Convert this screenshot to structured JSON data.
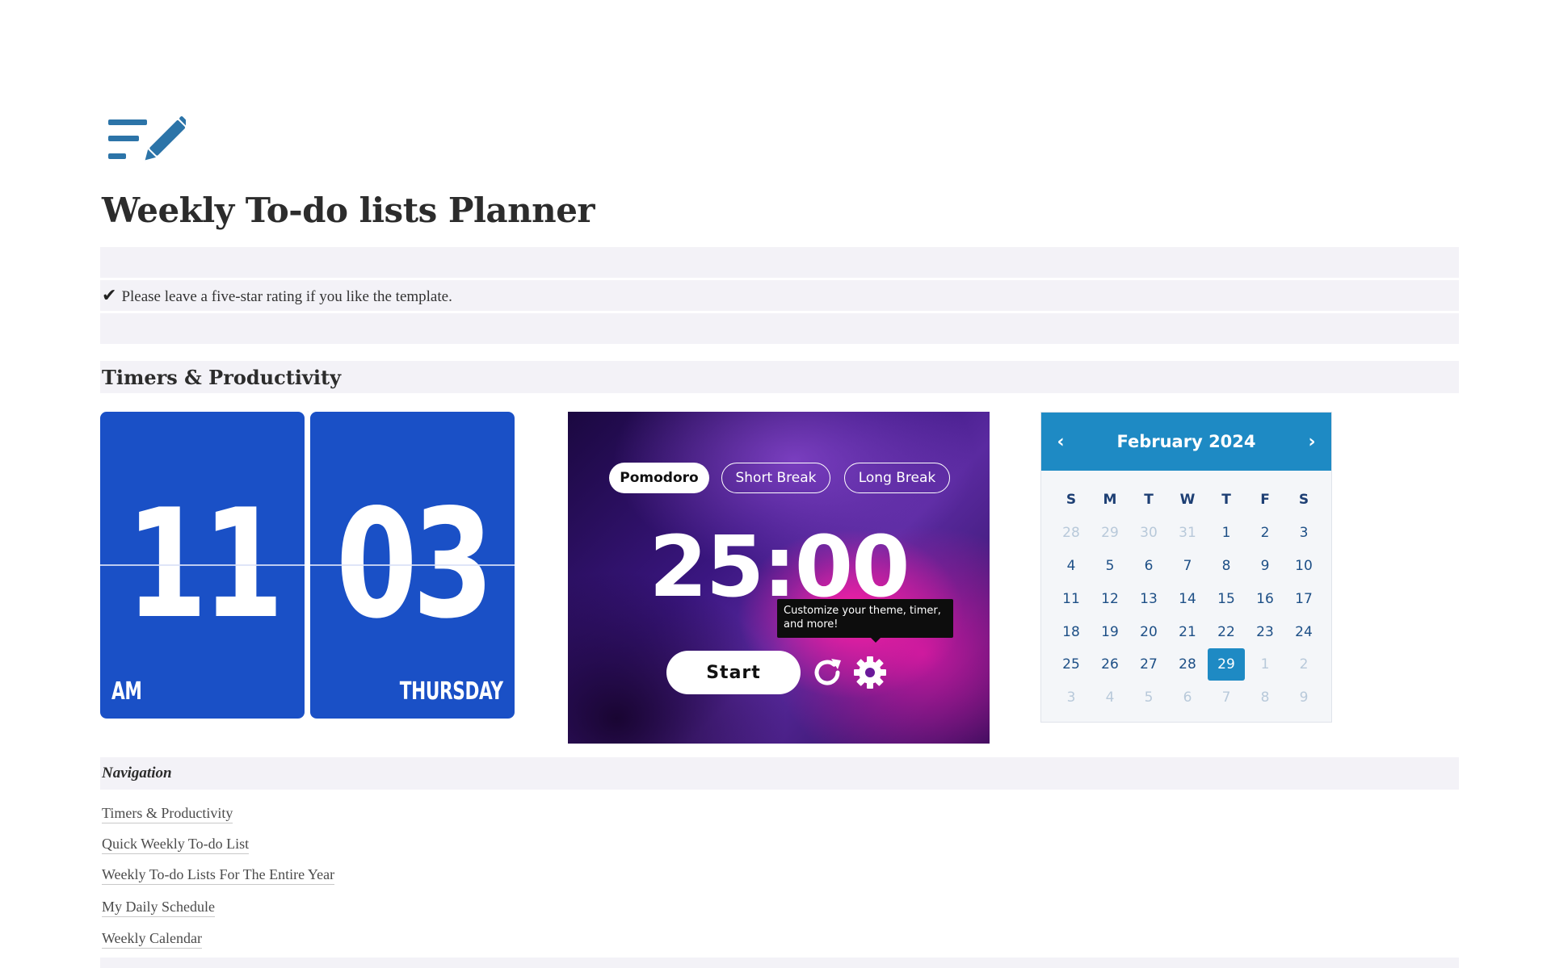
{
  "page": {
    "title": "Weekly To-do lists Planner",
    "rating_note": "Please leave a  five-star rating if you like the template.",
    "section_heading": "Timers & Productivity",
    "icons": {
      "logo": "notes-pencil-icon",
      "check": "check-icon"
    },
    "accent": "#2c74a8"
  },
  "clock": {
    "hour": "11",
    "minute": "03",
    "period": "AM",
    "day": "THURSDAY",
    "color": "#1a50c6"
  },
  "pomodoro": {
    "modes": [
      "Pomodoro",
      "Short Break",
      "Long Break"
    ],
    "active_mode": "Pomodoro",
    "time": "25:00",
    "tooltip": "Customize your theme, timer, and more!",
    "start_label": "Start",
    "icons": {
      "reset": "reset-icon",
      "settings": "gear-icon"
    }
  },
  "calendar": {
    "month_label": "February 2024",
    "prev_icon": "chevron-left-icon",
    "next_icon": "chevron-right-icon",
    "weekdays": [
      "S",
      "M",
      "T",
      "W",
      "T",
      "F",
      "S"
    ],
    "weeks": [
      [
        "28",
        "29",
        "30",
        "31",
        "1",
        "2",
        "3"
      ],
      [
        "4",
        "5",
        "6",
        "7",
        "8",
        "9",
        "10"
      ],
      [
        "11",
        "12",
        "13",
        "14",
        "15",
        "16",
        "17"
      ],
      [
        "18",
        "19",
        "20",
        "21",
        "22",
        "23",
        "24"
      ],
      [
        "25",
        "26",
        "27",
        "28",
        "29",
        "1",
        "2"
      ],
      [
        "3",
        "4",
        "5",
        "6",
        "7",
        "8",
        "9"
      ]
    ],
    "selected_day": "29",
    "header_color": "#1e8ac4"
  },
  "navigation": {
    "heading": "Navigation",
    "links": [
      "Timers & Productivity",
      "Quick Weekly To-do List",
      "Weekly To-do Lists For The Entire Year",
      "My Daily Schedule",
      "Weekly Calendar"
    ]
  }
}
